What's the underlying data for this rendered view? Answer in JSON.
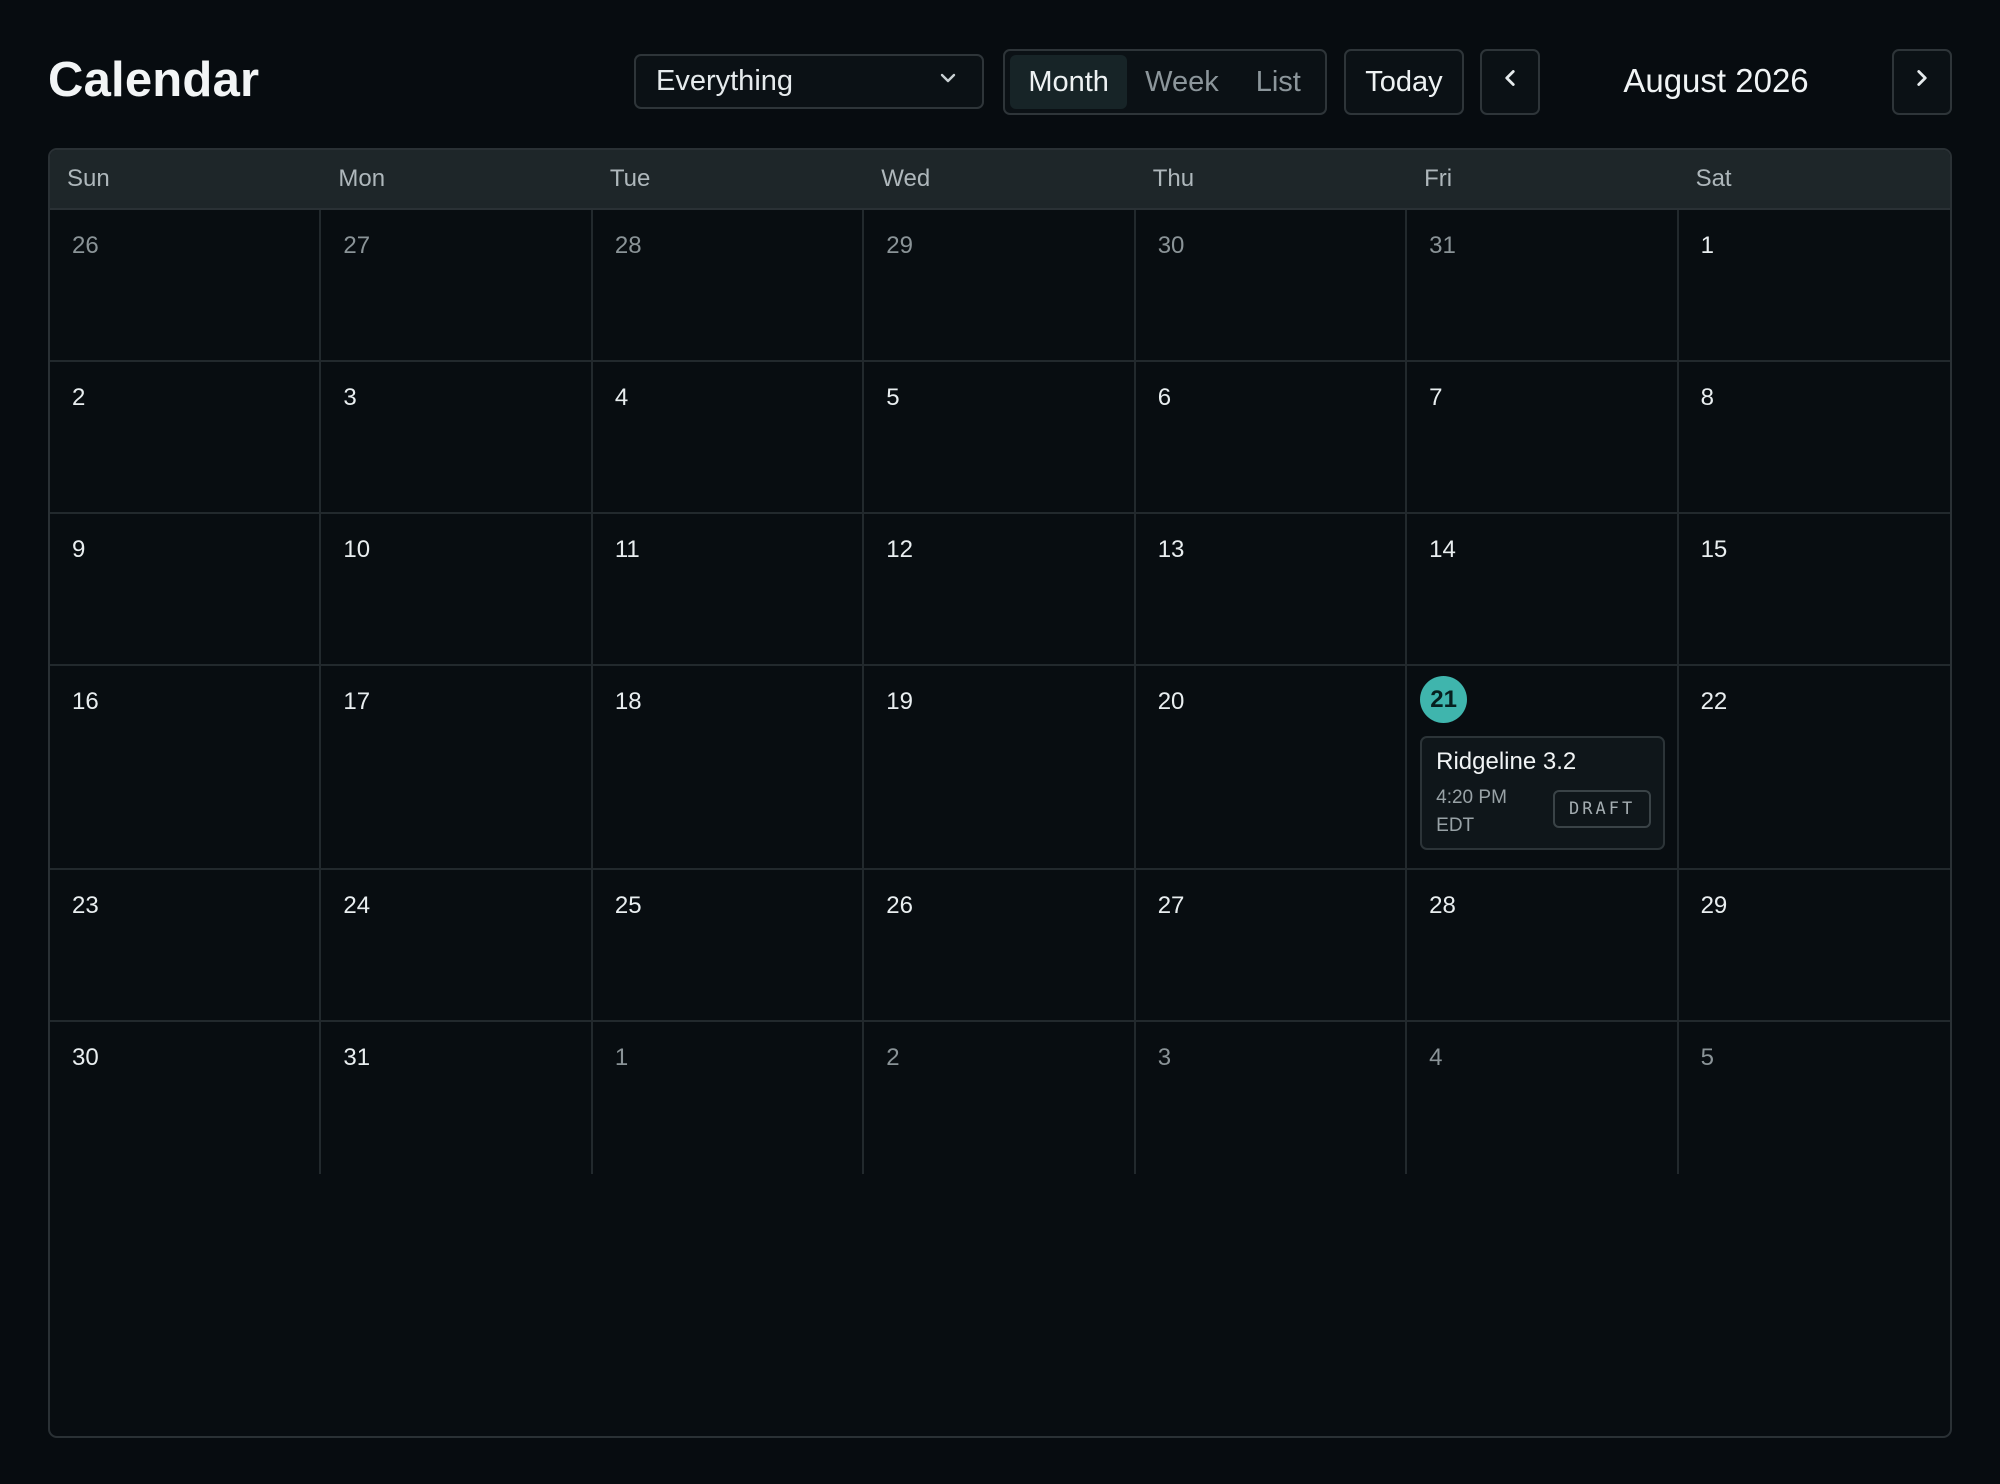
{
  "header": {
    "title": "Calendar",
    "filter_value": "Everything",
    "views": [
      {
        "label": "Month",
        "active": true
      },
      {
        "label": "Week",
        "active": false
      },
      {
        "label": "List",
        "active": false
      }
    ],
    "today_label": "Today",
    "month_label": "August 2026"
  },
  "weekdays": [
    "Sun",
    "Mon",
    "Tue",
    "Wed",
    "Thu",
    "Fri",
    "Sat"
  ],
  "weeks": [
    [
      {
        "n": "26",
        "muted": true
      },
      {
        "n": "27",
        "muted": true
      },
      {
        "n": "28",
        "muted": true
      },
      {
        "n": "29",
        "muted": true
      },
      {
        "n": "30",
        "muted": true
      },
      {
        "n": "31",
        "muted": true
      },
      {
        "n": "1"
      }
    ],
    [
      {
        "n": "2"
      },
      {
        "n": "3"
      },
      {
        "n": "4"
      },
      {
        "n": "5"
      },
      {
        "n": "6"
      },
      {
        "n": "7"
      },
      {
        "n": "8"
      }
    ],
    [
      {
        "n": "9"
      },
      {
        "n": "10"
      },
      {
        "n": "11"
      },
      {
        "n": "12"
      },
      {
        "n": "13"
      },
      {
        "n": "14"
      },
      {
        "n": "15"
      }
    ],
    [
      {
        "n": "16"
      },
      {
        "n": "17"
      },
      {
        "n": "18"
      },
      {
        "n": "19"
      },
      {
        "n": "20"
      },
      {
        "n": "21",
        "today": true,
        "events": [
          {
            "title": "Ridgeline 3.2",
            "time": "4:20 PM EDT",
            "badge": "DRAFT"
          }
        ]
      },
      {
        "n": "22"
      }
    ],
    [
      {
        "n": "23"
      },
      {
        "n": "24"
      },
      {
        "n": "25"
      },
      {
        "n": "26"
      },
      {
        "n": "27"
      },
      {
        "n": "28"
      },
      {
        "n": "29"
      }
    ],
    [
      {
        "n": "30"
      },
      {
        "n": "31"
      },
      {
        "n": "1",
        "muted": true
      },
      {
        "n": "2",
        "muted": true
      },
      {
        "n": "3",
        "muted": true
      },
      {
        "n": "4",
        "muted": true
      },
      {
        "n": "5",
        "muted": true
      }
    ]
  ],
  "colors": {
    "background": "#070c10",
    "accent": "#3fb5ad",
    "header_row": "#1e2629"
  },
  "icons": {
    "filter": "chevron-down-icon",
    "prev": "chevron-left-icon",
    "next": "chevron-right-icon"
  }
}
